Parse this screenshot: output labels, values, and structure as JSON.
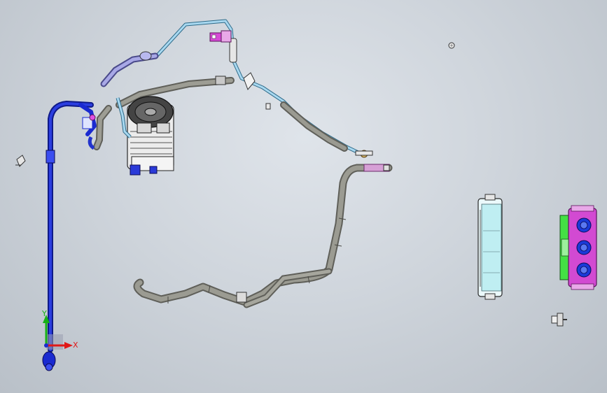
{
  "viewport": {
    "background": "#cfd5dc"
  },
  "triad": {
    "x_label": "X",
    "y_label": "Y",
    "x_color": "#e01818",
    "y_color": "#16b016"
  },
  "colors": {
    "hose_gray": "#8a8a82",
    "tube_light_blue": "#9fd0ea",
    "tube_blue": "#2233cc",
    "tube_lavender": "#9c9ce0",
    "fitting_magenta": "#d23ad2",
    "panel_green": "#44e044",
    "panel_cyan": "#bfeef2"
  },
  "components": [
    "discharge-hose",
    "suction-hose",
    "liquid-line",
    "ac-compressor",
    "pressure-switch",
    "blue-suction-tube",
    "evaporator-core",
    "climate-control-panel",
    "bolt-fastener"
  ]
}
